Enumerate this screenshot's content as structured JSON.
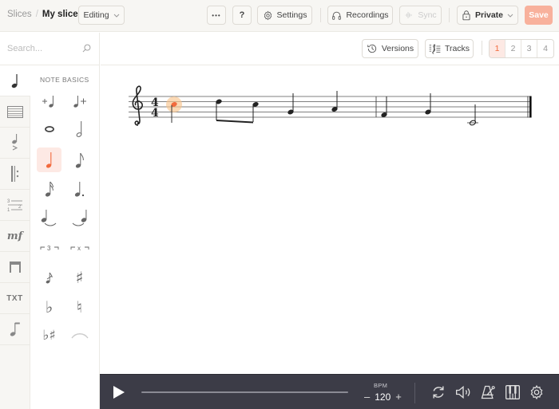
{
  "header": {
    "breadcrumb_root": "Slices",
    "breadcrumb_separator": "/",
    "slice_name": "My slice",
    "mode": "Editing",
    "more_label": "•••",
    "help_label": "?",
    "settings_label": "Settings",
    "recordings_label": "Recordings",
    "sync_label": "Sync",
    "privacy_label": "Private",
    "save_label": "Save"
  },
  "sidebar": {
    "search_placeholder": "Search...",
    "categories": [
      {
        "name": "notes",
        "icon": "quarter-note-icon",
        "active": true
      },
      {
        "name": "staff",
        "icon": "staff-lines-icon"
      },
      {
        "name": "articulations",
        "icon": "accent-note-icon"
      },
      {
        "name": "repeats",
        "icon": "repeat-sign-icon"
      },
      {
        "name": "measures",
        "icon": "time-signature-icon"
      },
      {
        "name": "dynamics",
        "icon": "dynamics-mf-icon",
        "label": "mf"
      },
      {
        "name": "endings",
        "icon": "volta-bracket-icon"
      },
      {
        "name": "text",
        "icon": "text-icon",
        "label": "TXT"
      },
      {
        "name": "grace",
        "icon": "flag-note-icon"
      }
    ],
    "palette_title": "NOTE BASICS",
    "palette_items": [
      {
        "name": "insert-note-before",
        "icon": "add-note-before-icon"
      },
      {
        "name": "insert-note-after",
        "icon": "add-note-after-icon"
      },
      {
        "name": "whole-note",
        "icon": "whole-note-icon"
      },
      {
        "name": "half-note",
        "icon": "half-note-icon"
      },
      {
        "name": "quarter-note",
        "icon": "quarter-note-icon",
        "active": true
      },
      {
        "name": "eighth-note",
        "icon": "eighth-note-icon"
      },
      {
        "name": "sixteenth-note",
        "icon": "sixteenth-note-icon"
      },
      {
        "name": "dotted-note",
        "icon": "dotted-note-icon"
      },
      {
        "name": "tie-left",
        "icon": "tie-left-icon"
      },
      {
        "name": "tie-right",
        "icon": "tie-right-icon"
      },
      {
        "name": "triplet",
        "icon": "triplet-icon",
        "label": "3"
      },
      {
        "name": "tuplet",
        "icon": "tuplet-icon",
        "label": "x"
      },
      {
        "name": "grace-note",
        "icon": "grace-note-icon"
      },
      {
        "name": "sharp",
        "icon": "sharp-icon",
        "label": "♯"
      },
      {
        "name": "flat",
        "icon": "flat-icon",
        "label": "♭"
      },
      {
        "name": "natural",
        "icon": "natural-icon",
        "label": "♮"
      },
      {
        "name": "flat-sharp",
        "icon": "flat-sharp-icon",
        "label": "♭♯"
      },
      {
        "name": "slur",
        "icon": "slur-icon"
      }
    ]
  },
  "score_toolbar": {
    "versions_label": "Versions",
    "tracks_label": "Tracks",
    "pages": [
      "1",
      "2",
      "3",
      "4"
    ],
    "active_page": "1"
  },
  "score": {
    "clef": "treble",
    "time_signature": "4/4",
    "accent_color": "#f26a3d",
    "measures": [
      {
        "notes": [
          "C5 quarter (selected)",
          "D5 eighth",
          "C5 eighth",
          "G4 quarter",
          "A4 quarter"
        ]
      },
      {
        "notes": [
          "F4 quarter",
          "G4 quarter",
          "C4 half"
        ]
      }
    ]
  },
  "player": {
    "play_label": "play",
    "bpm_label": "BPM",
    "bpm_value": "120",
    "bpm_minus": "–",
    "bpm_plus": "+",
    "progress": 0
  },
  "colors": {
    "accent": "#f26a3d",
    "save_bg": "#f8b19c",
    "player_bg": "#3c3c47",
    "topbar_bg": "#f7f6f3"
  }
}
